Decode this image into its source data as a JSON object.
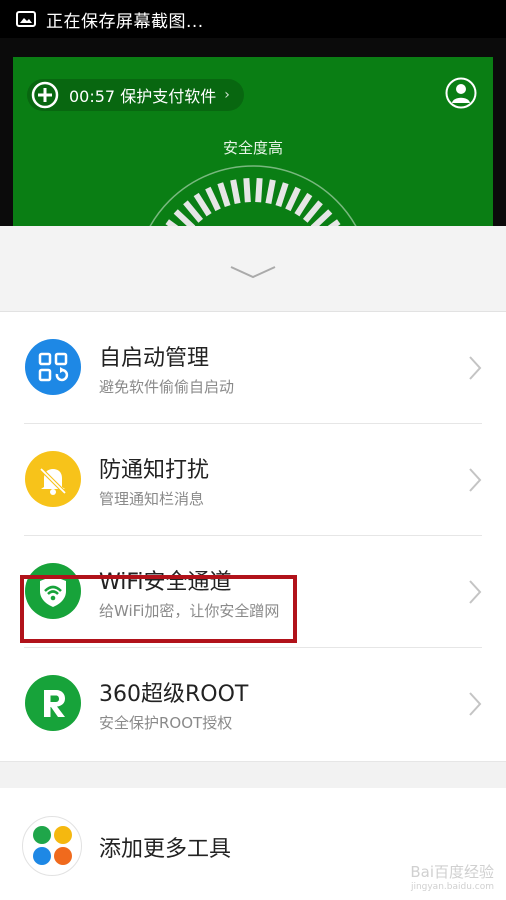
{
  "status_bar": {
    "text": "正在保存屏幕截图...",
    "icon": "image-icon"
  },
  "header": {
    "timer_text": "00:57 保护支付软件",
    "timer_arrow": "›",
    "safety_label": "安全度高",
    "bg_color": "#0a7e14"
  },
  "tools": [
    {
      "title": "自启动管理",
      "subtitle": "避免软件偷偷自启动",
      "icon": "autostart-grid-icon",
      "color": "#1e88e5"
    },
    {
      "title": "防通知打扰",
      "subtitle": "管理通知栏消息",
      "icon": "bell-muted-icon",
      "color": "#f7c31a"
    },
    {
      "title": "WiFi安全通道",
      "subtitle": "给WiFi加密，让你安全蹭网",
      "icon": "wifi-shield-icon",
      "color": "#17a33a"
    },
    {
      "title": "360超级ROOT",
      "subtitle": "安全保护ROOT授权",
      "icon": "root-r-icon",
      "color": "#17a33a"
    }
  ],
  "add_more": {
    "label": "添加更多工具",
    "highlight_color": "#b1121a"
  },
  "watermark": {
    "main": "Bai百度经验",
    "sub": "jingyan.baidu.com"
  }
}
